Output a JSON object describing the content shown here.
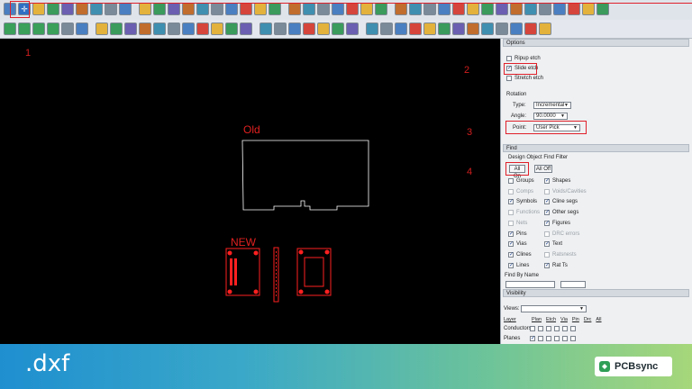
{
  "annotations": {
    "n1": "1",
    "n2": "2",
    "n3": "3",
    "n4": "4",
    "old": "Old",
    "new": "NEW"
  },
  "options": {
    "title": "Options",
    "rip_up": "Ripup etch",
    "slide": "Slide etch",
    "stretch": "Stretch etch",
    "rotation_label": "Rotation",
    "type_label": "Type:",
    "type_value": "Incremental",
    "angle_label": "Angle:",
    "angle_value": "90.0000",
    "point_label": "Point:",
    "point_value": "User Pick"
  },
  "find": {
    "title": "Find",
    "filter_title": "Design Object Find Filter",
    "all_on": "All On",
    "all_off": "All Off",
    "left": [
      {
        "label": "Groups",
        "checked": false,
        "disabled": false
      },
      {
        "label": "Comps",
        "checked": false,
        "disabled": true
      },
      {
        "label": "Symbols",
        "checked": true,
        "disabled": false
      },
      {
        "label": "Functions",
        "checked": false,
        "disabled": true
      },
      {
        "label": "Nets",
        "checked": false,
        "disabled": true
      },
      {
        "label": "Pins",
        "checked": true,
        "disabled": false
      },
      {
        "label": "Vias",
        "checked": true,
        "disabled": false
      },
      {
        "label": "Clines",
        "checked": true,
        "disabled": false
      },
      {
        "label": "Lines",
        "checked": true,
        "disabled": false
      }
    ],
    "right": [
      {
        "label": "Shapes",
        "checked": true,
        "disabled": false
      },
      {
        "label": "Voids/Cavities",
        "checked": false,
        "disabled": true
      },
      {
        "label": "Cline segs",
        "checked": true,
        "disabled": false
      },
      {
        "label": "Other segs",
        "checked": true,
        "disabled": false
      },
      {
        "label": "Figures",
        "checked": true,
        "disabled": false
      },
      {
        "label": "DRC errors",
        "checked": false,
        "disabled": true
      },
      {
        "label": "Text",
        "checked": true,
        "disabled": false
      },
      {
        "label": "Ratsnests",
        "checked": false,
        "disabled": true
      },
      {
        "label": "Rat Ts",
        "checked": true,
        "disabled": false
      }
    ],
    "find_by_name": "Find By Name"
  },
  "visibility": {
    "title": "Visibility",
    "views_label": "Views:",
    "cols": [
      "Layer",
      "Plan",
      "Etch",
      "Via",
      "Pin",
      "Drc",
      "All"
    ],
    "rows": [
      {
        "label": "Conductors"
      },
      {
        "label": "Planes"
      }
    ]
  },
  "banner": {
    "ext": ".dxf",
    "brand": "PCBsync",
    "bg_start": "#1f8fd0",
    "bg_end": "#a6d77a"
  },
  "colors": {
    "accent_red": "#e0202a",
    "outline_white": "#ffffff",
    "part_red": "#ff2020"
  }
}
